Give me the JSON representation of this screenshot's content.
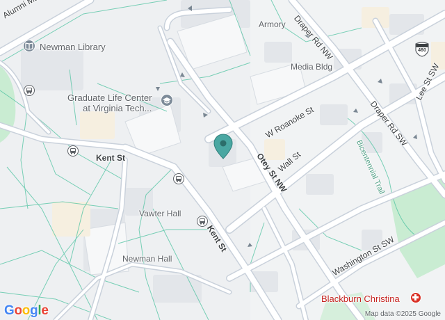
{
  "map": {
    "colors": {
      "background": "#f1f3f4",
      "building": "#e3e6ea",
      "road": "#ffffff",
      "road_casing": "#c9d1db",
      "major_road": "#b9c7d6",
      "path": "#4fc3a1",
      "park": "#c9ecd2",
      "pin": "#4aa7a2",
      "hospital": "#d93025"
    },
    "labels": {
      "alumni_mall": "Alumni Mall",
      "armory": "Armory",
      "draper_rd_nw": "Draper Rd NW",
      "newman_library": "Newman Library",
      "media_bldg": "Media Bldg",
      "graduate_life_center": "Graduate Life Center\nat Virginia Tech...",
      "w_roanoke_st": "W Roanoke St",
      "draper_rd_sw": "Draper Rd SW",
      "lee_st_sw": "Lee St SW",
      "kent_st_west": "Kent St",
      "kent_st_south": "Kent St",
      "otey_st_nw": "Otey St NW",
      "wall_st": "Wall St",
      "bicentennial_trail": "Bicentennial Trail",
      "vawter_hall": "Vawter Hall",
      "washington_st_sw": "Washington St SW",
      "newman_hall": "Newman Hall",
      "blackburn_christina": "Blackburn Christina",
      "route_shield": "460"
    },
    "icons": {
      "library": "library-icon",
      "graduate": "graduation-cap-icon",
      "bus": "bus-stop-icon",
      "hospital": "hospital-icon",
      "pin": "location-pin-icon"
    },
    "footer": {
      "attribution": "Map data ©2025 Google",
      "logo": "Google"
    }
  }
}
